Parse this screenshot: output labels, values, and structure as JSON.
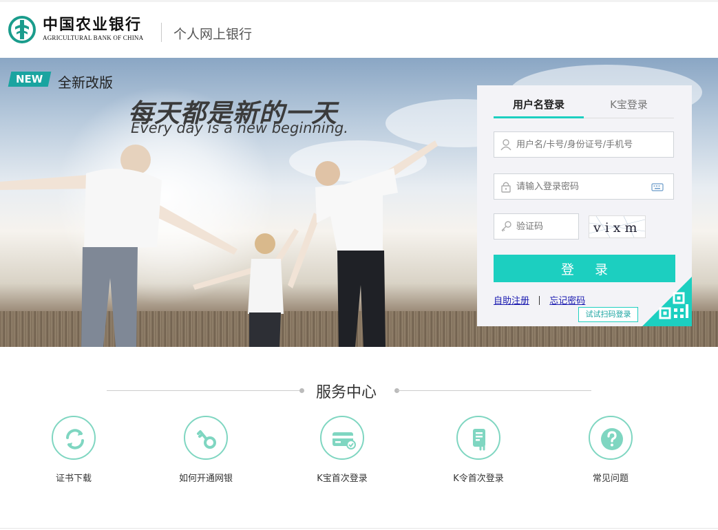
{
  "header": {
    "brand_cn": "中国农业银行",
    "brand_en": "AGRICULTURAL BANK OF CHINA",
    "subtitle": "个人网上银行"
  },
  "hero": {
    "badge": "NEW",
    "version_text": "全新改版",
    "title": "每天都是新的一天",
    "subtitle": "Every day is a new beginning."
  },
  "login": {
    "tabs": [
      {
        "label": "用户名登录",
        "active": true
      },
      {
        "label": "K宝登录",
        "active": false
      }
    ],
    "username_placeholder": "用户名/卡号/身份证号/手机号",
    "password_placeholder": "请输入登录密码",
    "captcha_placeholder": "验证码",
    "captcha_text": "vixm",
    "submit_label": "登 录",
    "register_link": "自助注册",
    "forgot_link": "忘记密码",
    "qr_tip": "试试扫码登录"
  },
  "service": {
    "title": "服务中心",
    "items": [
      {
        "label": "证书下载",
        "icon": "refresh-icon"
      },
      {
        "label": "如何开通网银",
        "icon": "key-icon"
      },
      {
        "label": "K宝首次登录",
        "icon": "card-icon"
      },
      {
        "label": "K令首次登录",
        "icon": "token-icon"
      },
      {
        "label": "常见问题",
        "icon": "question-icon"
      }
    ]
  },
  "colors": {
    "accent": "#1ccfc0",
    "brand_green": "#1a9c8c",
    "icon_ring": "#7fd6c1"
  }
}
